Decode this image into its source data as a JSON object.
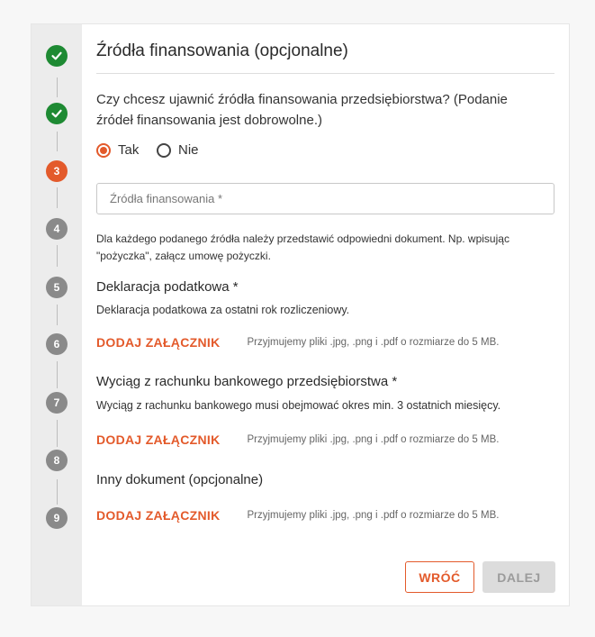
{
  "form": {
    "title": "Źródła finansowania (opcjonalne)",
    "question": "Czy chcesz ujawnić źródła finansowania przedsiębiorstwa? (Podanie źródeł finansowania jest dobrowolne.)",
    "radio_yes": "Tak",
    "radio_no": "Nie",
    "selected": "Tak",
    "funding_placeholder": "Źródła finansowania *",
    "funding_value": "",
    "funding_note": "Dla każdego podanego źródła należy przedstawić odpowiedni dokument. Np. wpisując \"pożyczka\", załącz umowę pożyczki."
  },
  "steps": [
    {
      "label": "1",
      "state": "done",
      "icon": "check-icon"
    },
    {
      "label": "2",
      "state": "done",
      "icon": "check-icon"
    },
    {
      "label": "3",
      "state": "active"
    },
    {
      "label": "4",
      "state": "todo"
    },
    {
      "label": "5",
      "state": "todo"
    },
    {
      "label": "6",
      "state": "todo"
    },
    {
      "label": "7",
      "state": "todo"
    },
    {
      "label": "8",
      "state": "todo"
    },
    {
      "label": "9",
      "state": "todo"
    }
  ],
  "sections": [
    {
      "title": "Deklaracja podatkowa *",
      "description": "Deklaracja podatkowa za ostatni rok rozliczeniowy.",
      "attach_label": "DODAJ ZAŁĄCZNIK",
      "hint": "Przyjmujemy pliki .jpg, .png i .pdf o rozmiarze do 5 MB."
    },
    {
      "title": "Wyciąg z rachunku bankowego przedsiębiorstwa *",
      "description": "Wyciąg z rachunku bankowego musi obejmować okres min. 3 ostatnich miesięcy.",
      "attach_label": "DODAJ ZAŁĄCZNIK",
      "hint": "Przyjmujemy pliki .jpg, .png i .pdf o rozmiarze do 5 MB."
    },
    {
      "title": "Inny dokument (opcjonalne)",
      "attach_label": "DODAJ ZAŁĄCZNIK",
      "hint": "Przyjmujemy pliki .jpg, .png i .pdf o rozmiarze do 5 MB."
    }
  ],
  "buttons": {
    "back": "WRÓĆ",
    "next": "DALEJ",
    "next_enabled": false
  },
  "colors": {
    "accent": "#e35a2b",
    "done": "#1e8a33",
    "todo": "#8a8a8a"
  }
}
